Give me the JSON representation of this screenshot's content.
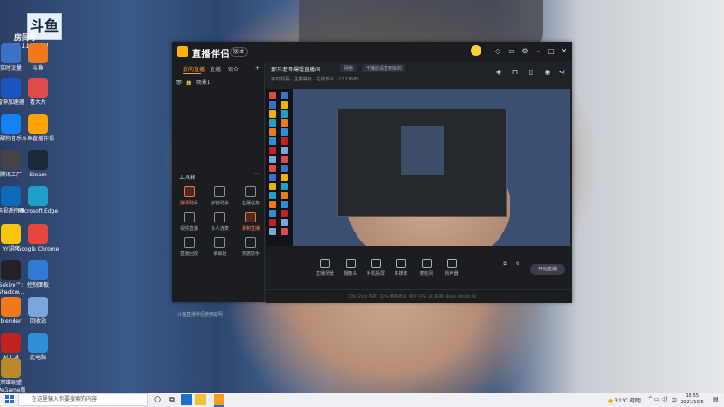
{
  "desktop": {
    "badge_text": "斗鱼",
    "room_label": "房间号",
    "room_number": "1110680",
    "icons": [
      {
        "label": "实时流量",
        "color": "#3a72c4"
      },
      {
        "label": "斗鱼",
        "color": "#f07a1a"
      },
      {
        "label": "雷神加速器",
        "color": "#1b55c0"
      },
      {
        "label": "看大片",
        "color": "#e14a4a"
      },
      {
        "label": "酷狗音乐",
        "color": "#1680f5"
      },
      {
        "label": "斗鱼直播伴侣",
        "color": "#ffa300"
      },
      {
        "label": "腾讯工厂",
        "color": "#444"
      },
      {
        "label": "Steam",
        "color": "#1b2838"
      },
      {
        "label": "电视遥控器",
        "color": "#0e6ab8"
      },
      {
        "label": "Microsoft Edge",
        "color": "#1fa0c9"
      },
      {
        "label": "YY语音",
        "color": "#f8c50c"
      },
      {
        "label": "Google Chrome",
        "color": "#e8453c"
      },
      {
        "label": "Sekiro™: Shadow...",
        "color": "#222"
      },
      {
        "label": "控制面板",
        "color": "#2d7bd4"
      },
      {
        "label": "blender",
        "color": "#f07a1a"
      },
      {
        "label": "回收站",
        "color": "#7aa7d9"
      },
      {
        "label": "ALTT4",
        "color": "#c02222"
      },
      {
        "label": "此电脑",
        "color": "#2d8fd8"
      },
      {
        "label": "英雄联盟 WeGame版",
        "color": "#b88a2a"
      }
    ]
  },
  "app": {
    "name": "直播伴侣",
    "version_tag": "版本",
    "tabs": [
      "我的直播",
      "直播",
      "观众"
    ],
    "scene_label": "场景1",
    "room_title": "那只老哥爆粗直播间",
    "tags": [
      "网络",
      "开播前请签到好的"
    ],
    "info_line": "实时观看 · 主播等级 · 在线观众 · 1110680",
    "tools_title": "工具箱",
    "tools": [
      {
        "label": "弹幕助手",
        "hl": true
      },
      {
        "label": "房管助手",
        "hl": false
      },
      {
        "label": "主播任务",
        "hl": false
      },
      {
        "label": "视频直播",
        "hl": false
      },
      {
        "label": "多人连麦",
        "hl": false
      },
      {
        "label": "录制直播",
        "hl": true
      },
      {
        "label": "直播回放",
        "hl": false
      },
      {
        "label": "弹幕姬",
        "hl": false
      },
      {
        "label": "数据助手",
        "hl": false
      }
    ],
    "side_footer": "斗鱼直播伴侣使用说明",
    "controls": [
      "直播场景",
      "摄像头",
      "手机投屏",
      "多媒体",
      "麦克风",
      "扬声器"
    ],
    "start_live": "开始直播",
    "status": "CPU: 21%   内存: 32%   网络状态: 良好   FPS: 30   码率: 0kb/s   00:00:00"
  },
  "taskbar": {
    "search_placeholder": "在这里输入你要搜索的内容",
    "weather": "31°C 晴朗",
    "time": "18:55",
    "date": "2021/10/6",
    "lang": "中"
  }
}
